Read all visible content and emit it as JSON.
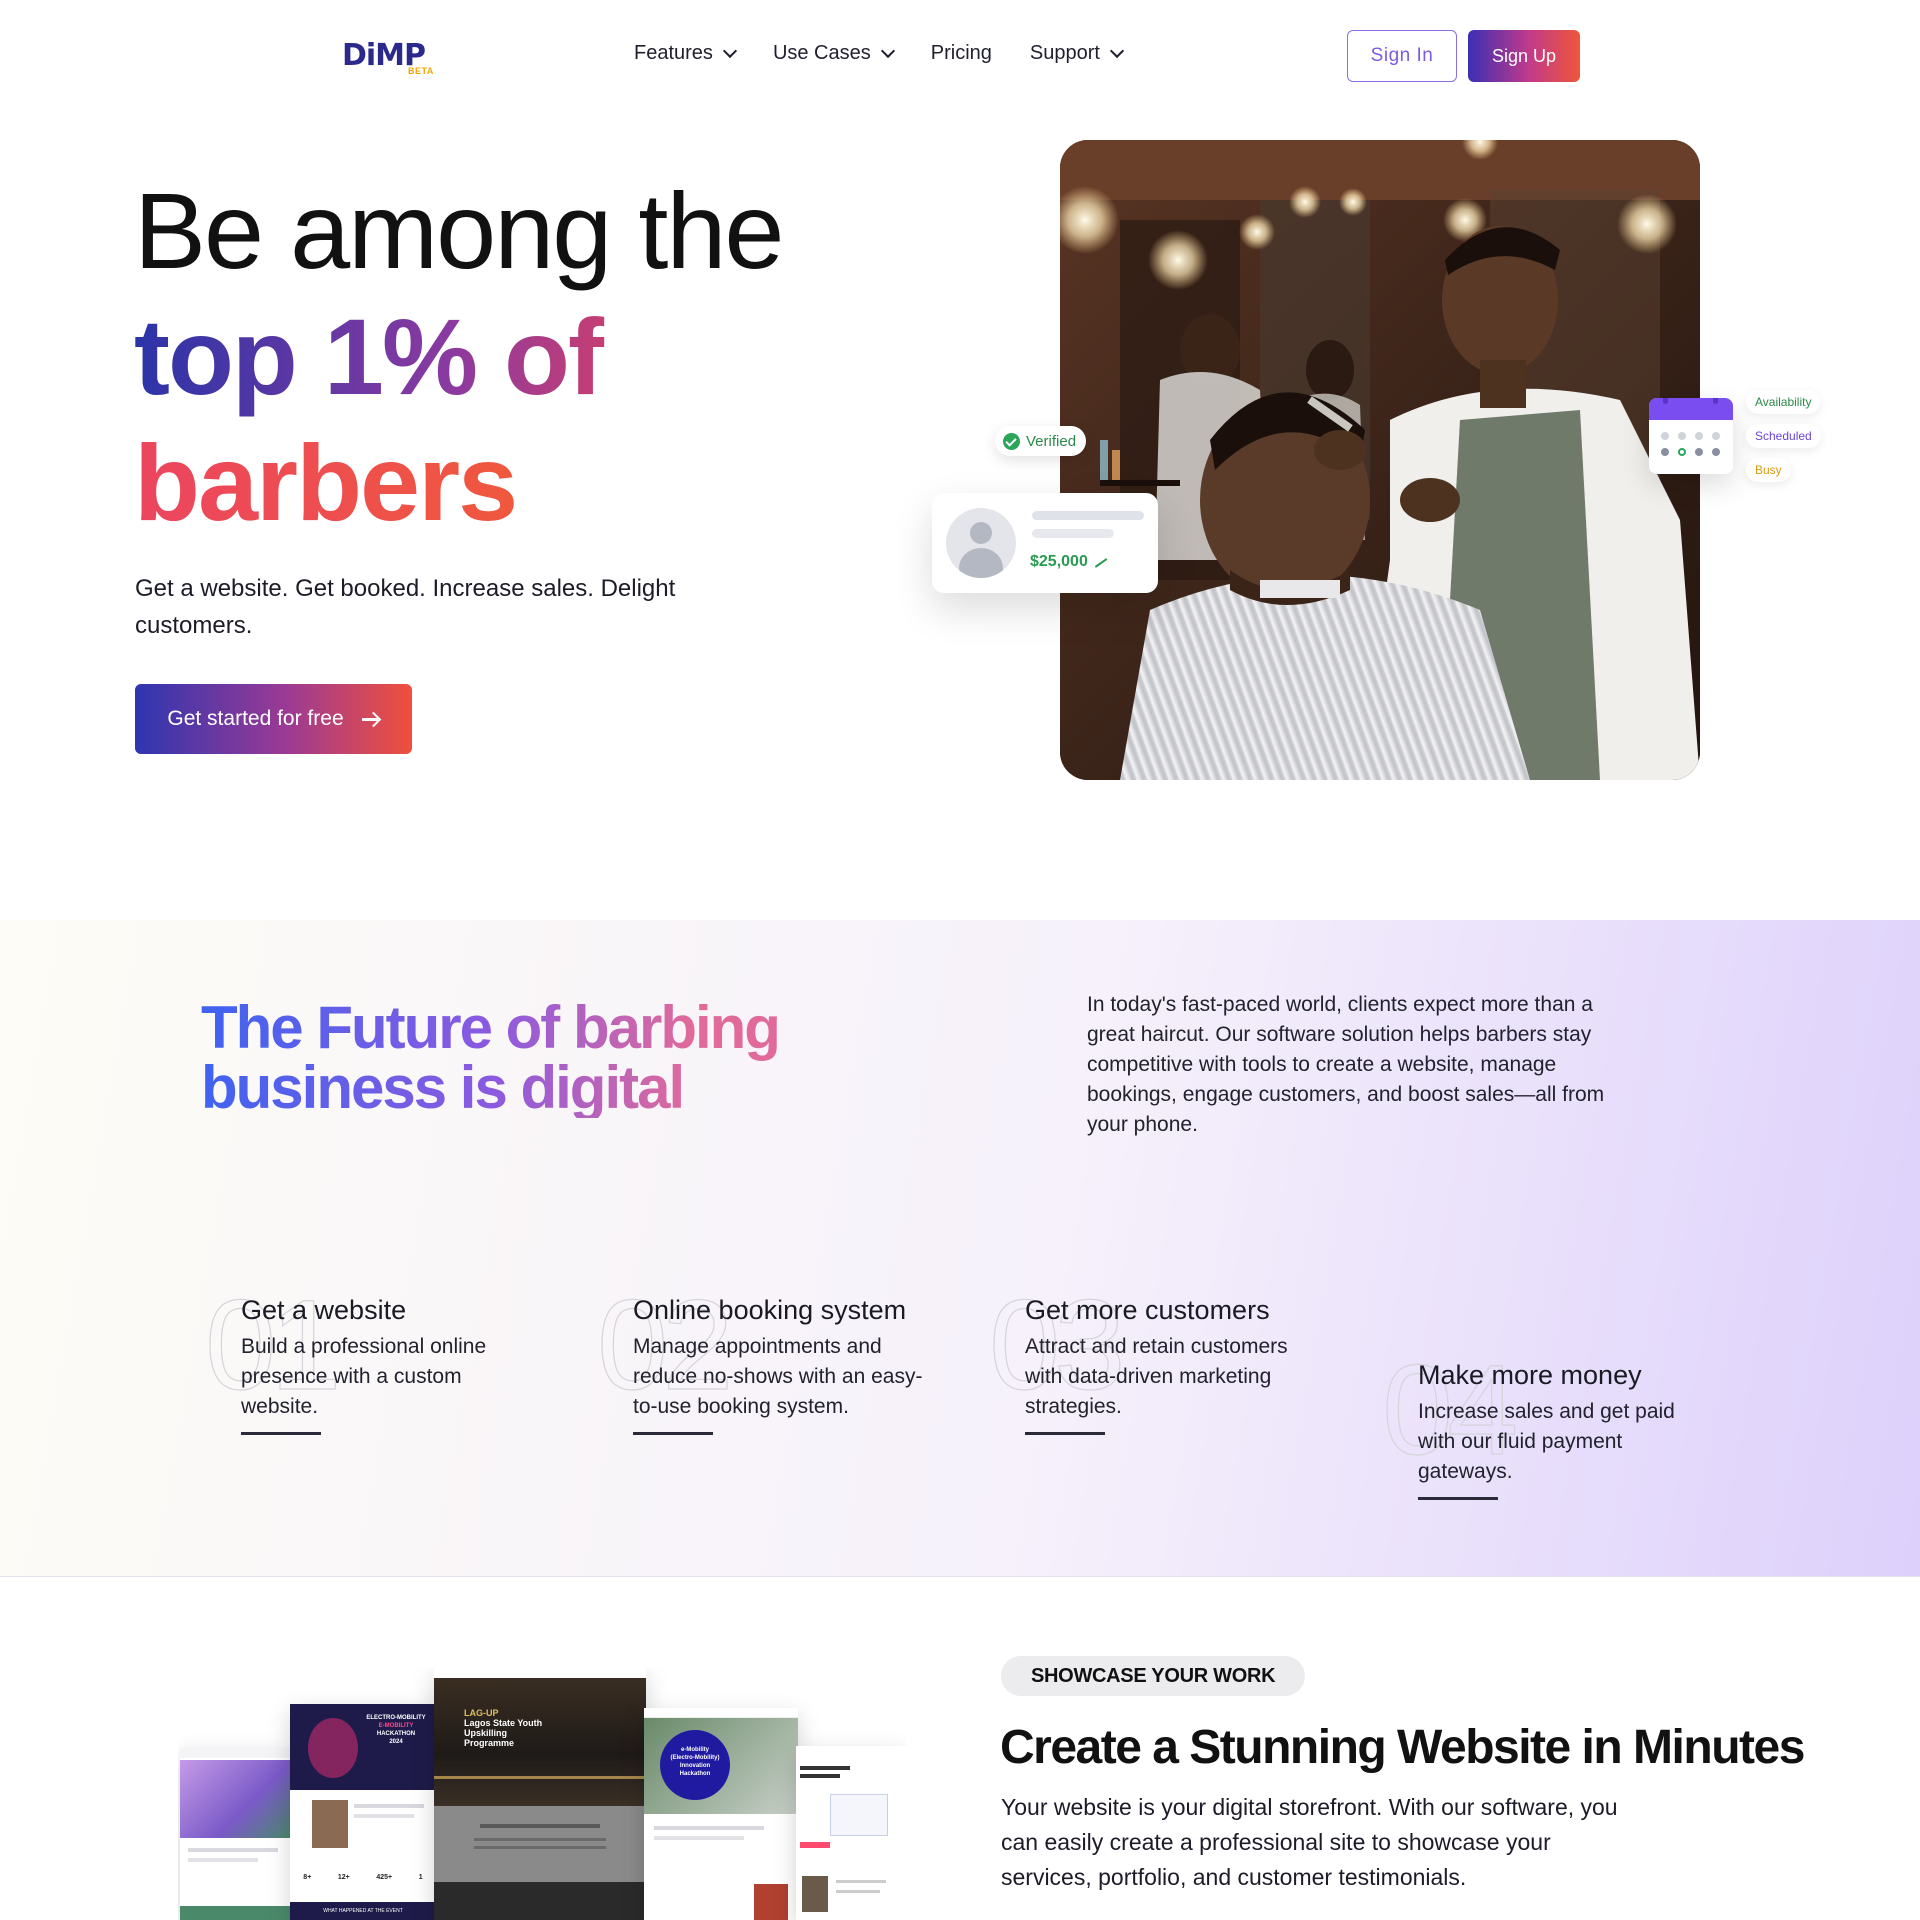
{
  "nav": {
    "logo_text": "DiMP",
    "logo_badge": "BETA",
    "items": [
      {
        "label": "Features",
        "has_dropdown": true
      },
      {
        "label": "Use Cases",
        "has_dropdown": true
      },
      {
        "label": "Pricing",
        "has_dropdown": false
      },
      {
        "label": "Support",
        "has_dropdown": true
      }
    ],
    "signin_label": "Sign In",
    "signup_label": "Sign Up"
  },
  "hero": {
    "title_line1": "Be among the",
    "title_line2": "top 1% of",
    "title_line3": "barbers",
    "subtitle": "Get a website. Get booked. Increase sales. Delight customers.",
    "cta_label": "Get started for free",
    "verified_label": "Verified",
    "amount": "$25,000",
    "status_pills": [
      "Availability",
      "Scheduled",
      "Busy"
    ]
  },
  "future": {
    "title_line1": "The Future of barbing",
    "title_line2": "business is digital",
    "description": "In today's fast-paced world, clients expect more than a great haircut. Our software solution helps barbers stay competitive with tools to create a website, manage bookings, engage customers, and boost sales—all from your phone.",
    "features": [
      {
        "number": "01",
        "title": "Get a website",
        "description": "Build a professional online presence with a custom website."
      },
      {
        "number": "02",
        "title": "Online booking system",
        "description": "Manage appointments and reduce no-shows with an easy-to-use booking system."
      },
      {
        "number": "03",
        "title": "Get more customers",
        "description": "Attract and retain customers with data-driven marketing strategies."
      },
      {
        "number": "04",
        "title": "Make more money",
        "description": "Increase sales and get paid with our fluid payment gateways."
      }
    ]
  },
  "showcase": {
    "tag": "SHOWCASE YOUR WORK",
    "title": "Create a Stunning Website in Minutes",
    "description": "Your website is your digital storefront. With our software, you can easily create a professional site to showcase your services, portfolio, and customer testimonials.",
    "collage": {
      "shot_hackathon": {
        "line1": "ELECTRO-MOBILITY",
        "line2": "E-MOBILITY",
        "line3": "HACKATHON",
        "line4": "2024",
        "stats": [
          "8+",
          "12+",
          "425+",
          "1"
        ],
        "footer": "WHAT HAPPENED AT THE EVENT"
      },
      "shot_lagos": {
        "line1": "LAG-UP",
        "line2": "Lagos State Youth",
        "line3": "Upskilling",
        "line4": "Programme"
      },
      "shot_emobility": {
        "line1": "e-Mobility",
        "line2": "(Electro-Mobility)",
        "line3": "Innovation",
        "line4": "Hackathon"
      }
    }
  }
}
